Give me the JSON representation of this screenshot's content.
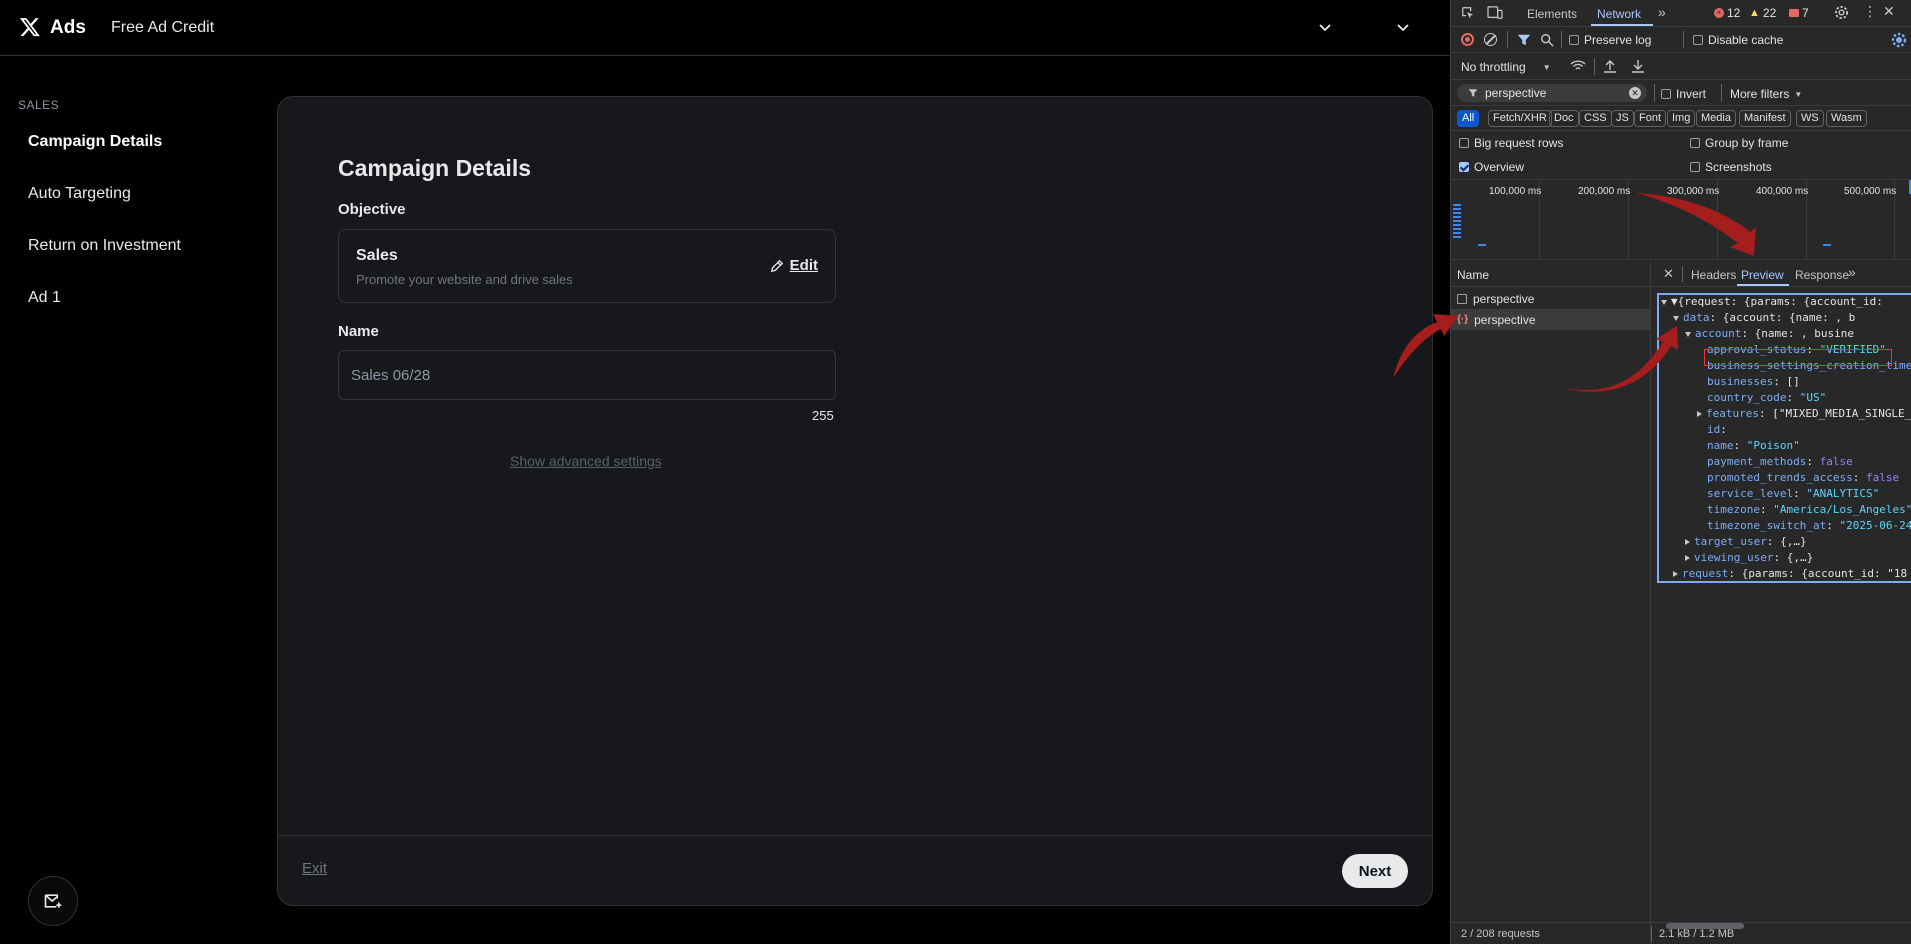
{
  "app": {
    "brand": "Ads",
    "credit_link": "Free Ad Credit",
    "sidebar": {
      "heading": "SALES",
      "items": [
        {
          "label": "Campaign Details",
          "active": true
        },
        {
          "label": "Auto Targeting",
          "active": false
        },
        {
          "label": "Return on Investment",
          "active": false
        },
        {
          "label": "Ad 1",
          "active": false
        }
      ]
    },
    "form": {
      "title": "Campaign Details",
      "objective_label": "Objective",
      "objective_title": "Sales",
      "objective_desc": "Promote your website and drive sales",
      "edit_label": "Edit",
      "name_label": "Name",
      "name_placeholder": "Sales 06/28",
      "char_count": "255",
      "advanced_link": "Show advanced settings",
      "exit_label": "Exit",
      "next_label": "Next"
    }
  },
  "devtools": {
    "tabs": {
      "elements": "Elements",
      "network": "Network"
    },
    "badges": {
      "errors": "12",
      "warnings": "22",
      "issues": "7"
    },
    "toolbar": {
      "preserve_log": "Preserve log",
      "disable_cache": "Disable cache",
      "throttling": "No throttling"
    },
    "filter": {
      "value": "perspective",
      "invert": "Invert",
      "more_filters": "More filters"
    },
    "type_chips": [
      "All",
      "Fetch/XHR",
      "Doc",
      "CSS",
      "JS",
      "Font",
      "Img",
      "Media",
      "Manifest",
      "WS",
      "Wasm"
    ],
    "options": {
      "big_rows": "Big request rows",
      "group_by_frame": "Group by frame",
      "overview": "Overview",
      "screenshots": "Screenshots"
    },
    "overview_ticks": [
      "100,000 ms",
      "200,000 ms",
      "300,000 ms",
      "400,000 ms",
      "500,000 ms"
    ],
    "name_header": "Name",
    "requests": [
      "perspective",
      "perspective"
    ],
    "preview_tabs": {
      "headers": "Headers",
      "preview": "Preview",
      "response": "Response"
    },
    "json_lines": [
      {
        "t": "▼{request: {params: {account_id:"
      },
      {
        "k": "data",
        "t": ": {account: {name:        , b"
      },
      {
        "k": "account",
        "t": ": {name:        , busine"
      },
      {
        "k": "approval_status",
        "t": ": ",
        "s": "\"VERIFIED\""
      },
      {
        "k": "business_settings_creation_time",
        "t": ""
      },
      {
        "k": "businesses",
        "t": ": []"
      },
      {
        "k": "country_code",
        "t": ": ",
        "s": "\"US\""
      },
      {
        "k": "features",
        "t": ": [\"MIXED_MEDIA_SINGLE_"
      },
      {
        "k": "id",
        "t": ":"
      },
      {
        "k": "name",
        "t": ": ",
        "s": "\"Poison\""
      },
      {
        "k": "payment_methods",
        "t": ": ",
        "b": "false"
      },
      {
        "k": "promoted_trends_access",
        "t": ": ",
        "b": "false"
      },
      {
        "k": "service_level",
        "t": ": ",
        "s": "\"ANALYTICS\""
      },
      {
        "k": "timezone",
        "t": ": ",
        "s": "\"America/Los_Angeles\""
      },
      {
        "k": "timezone_switch_at",
        "t": ": ",
        "s": "\"2025-06-24"
      },
      {
        "k": "target_user",
        "t": ": {,…}"
      },
      {
        "k": "viewing_user",
        "t": ": {,…}"
      },
      {
        "k": "request",
        "t": ": {params: {account_id: \"18"
      }
    ],
    "status": {
      "requests": "2 / 208 requests",
      "transfer": "2.1 kB / 1.2 MB"
    },
    "colors": {
      "accent": "#a8c7fa",
      "highlight": "#e53935",
      "arrow": "#b71c1c"
    }
  }
}
